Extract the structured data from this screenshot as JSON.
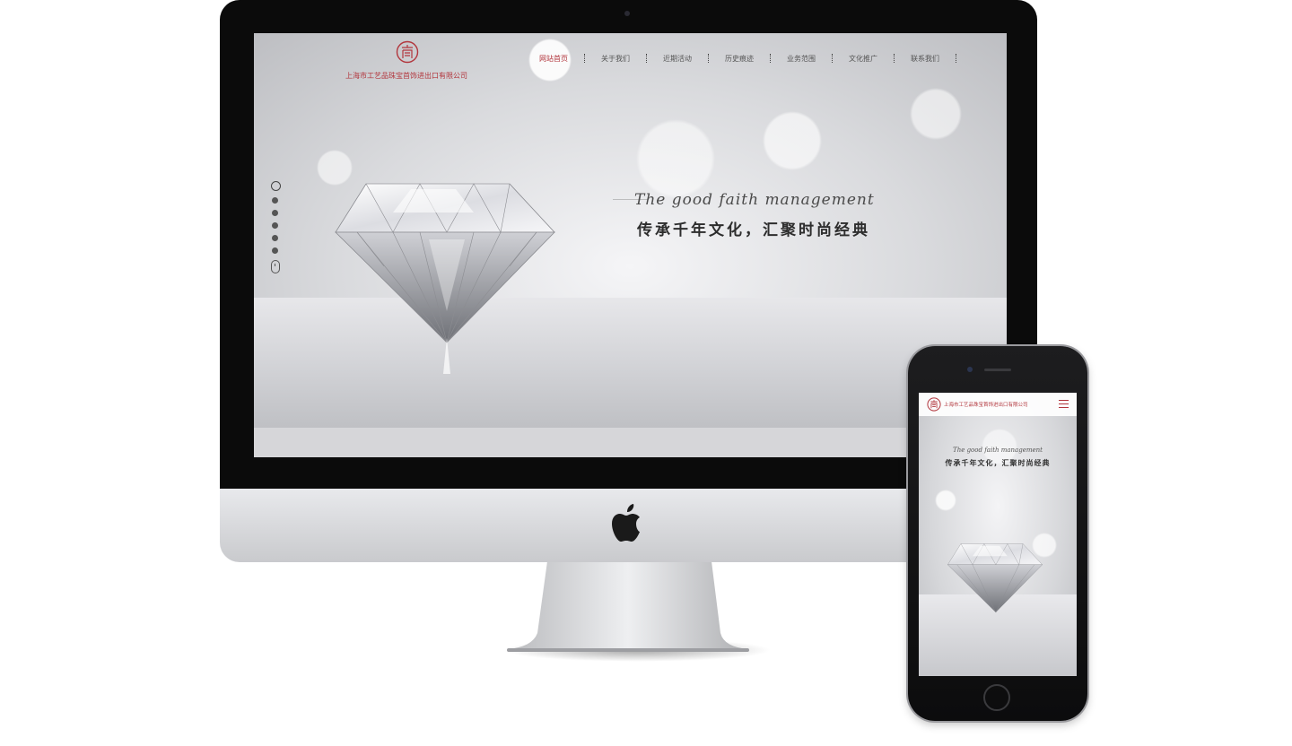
{
  "site": {
    "company_name": "上海市工艺品珠宝首饰进出口有限公司",
    "logo_glyph": "商"
  },
  "nav": {
    "items": [
      {
        "label": "网站首页",
        "active": true
      },
      {
        "label": "关于我们",
        "active": false
      },
      {
        "label": "近期活动",
        "active": false
      },
      {
        "label": "历史痕迹",
        "active": false
      },
      {
        "label": "业务范围",
        "active": false
      },
      {
        "label": "文化推广",
        "active": false
      },
      {
        "label": "联系我们",
        "active": false
      }
    ]
  },
  "hero": {
    "tagline_en": "The good faith management",
    "tagline_cn": "传承千年文化，汇聚时尚经典",
    "slide_count": 6,
    "active_slide": 1
  },
  "mobile": {
    "company_name": "上海市工艺品珠宝首饰进出口有限公司",
    "tagline_en": "The good faith management",
    "tagline_cn": "传承千年文化，汇聚时尚经典",
    "menu_icon": "hamburger-icon"
  },
  "colors": {
    "brand_red": "#b2363d",
    "bezel": "#0b0b0b"
  }
}
